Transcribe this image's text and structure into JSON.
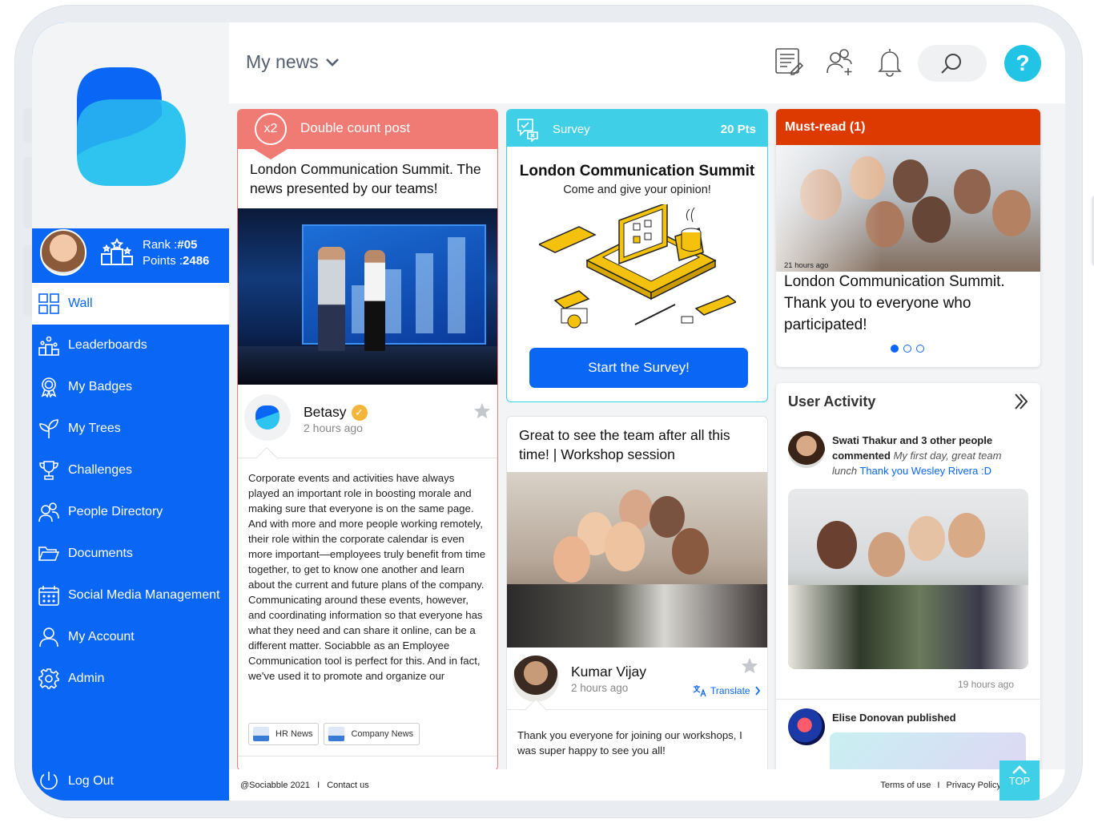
{
  "sidebar": {
    "rank_label": "Rank :",
    "rank_value": "#05",
    "points_label": "Points :",
    "points_value": "2486",
    "items": [
      {
        "label": "Wall",
        "icon": "grid-icon"
      },
      {
        "label": "Leaderboards",
        "icon": "podium-icon"
      },
      {
        "label": "My Badges",
        "icon": "badge-icon"
      },
      {
        "label": "My Trees",
        "icon": "sprout-icon"
      },
      {
        "label": "Challenges",
        "icon": "trophy-icon"
      },
      {
        "label": "People Directory",
        "icon": "people-icon"
      },
      {
        "label": "Documents",
        "icon": "folder-icon"
      },
      {
        "label": "Social Media Management",
        "icon": "calendar-icon"
      },
      {
        "label": "My Account",
        "icon": "user-icon"
      },
      {
        "label": "Admin",
        "icon": "gear-icon"
      }
    ],
    "logout_label": "Log Out"
  },
  "header": {
    "title": "My news",
    "help_label": "?"
  },
  "post1": {
    "badge": "x2",
    "header_label": "Double count post",
    "title": "London Communication Summit. The news presented by our teams!",
    "author": "Betasy",
    "time": "2 hours ago",
    "body": "Corporate events and activities have always played an important role in boosting morale and making sure that everyone is on the same page. And with more and more people working remotely, their role within the corporate calendar is even more important—employees truly benefit from time together, to get to know one another and learn about the current and future plans of the company. Communicating around these events, however, and coordinating information so that everyone has what they need and can share it online, can be a different matter. Sociabble as an Employee Communication tool is perfect for this. And in fact, we've used it to promote and organize our",
    "tags": [
      "HR News",
      "Company News"
    ]
  },
  "survey": {
    "label": "Survey",
    "points": "20 Pts",
    "title": "London Communication Summit",
    "subtitle": "Come and give your opinion!",
    "button": "Start the Survey!"
  },
  "post2": {
    "title": "Great to see the team after all this time! | Workshop session",
    "author": "Kumar Vijay",
    "time": "2 hours ago",
    "translate": "Translate",
    "body": "Thank you everyone for joining our workshops, I was super happy to see you all!"
  },
  "must_read": {
    "header": "Must-read (1)",
    "time": "21 hours ago",
    "title": "London Communication Summit. Thank you to everyone who participated!"
  },
  "activity": {
    "title": "User Activity",
    "item1_actor": "Swati Thakur and 3 other people commented",
    "item1_comment": "My first day, great team lunch",
    "item1_link": "Thank you Wesley Rivera :D",
    "item1_time": "19 hours ago",
    "item2_text": "Elise Donovan published"
  },
  "footer": {
    "copyright": "@Sociabble 2021",
    "contact": "Contact us",
    "terms": "Terms of use",
    "privacy": "Privacy Policy",
    "separator": "I",
    "top": "TOP"
  },
  "colors": {
    "primary": "#0a66f5",
    "cyan": "#3fd0e8",
    "double_count": "#f07b74",
    "must_read": "#dc3a00"
  }
}
